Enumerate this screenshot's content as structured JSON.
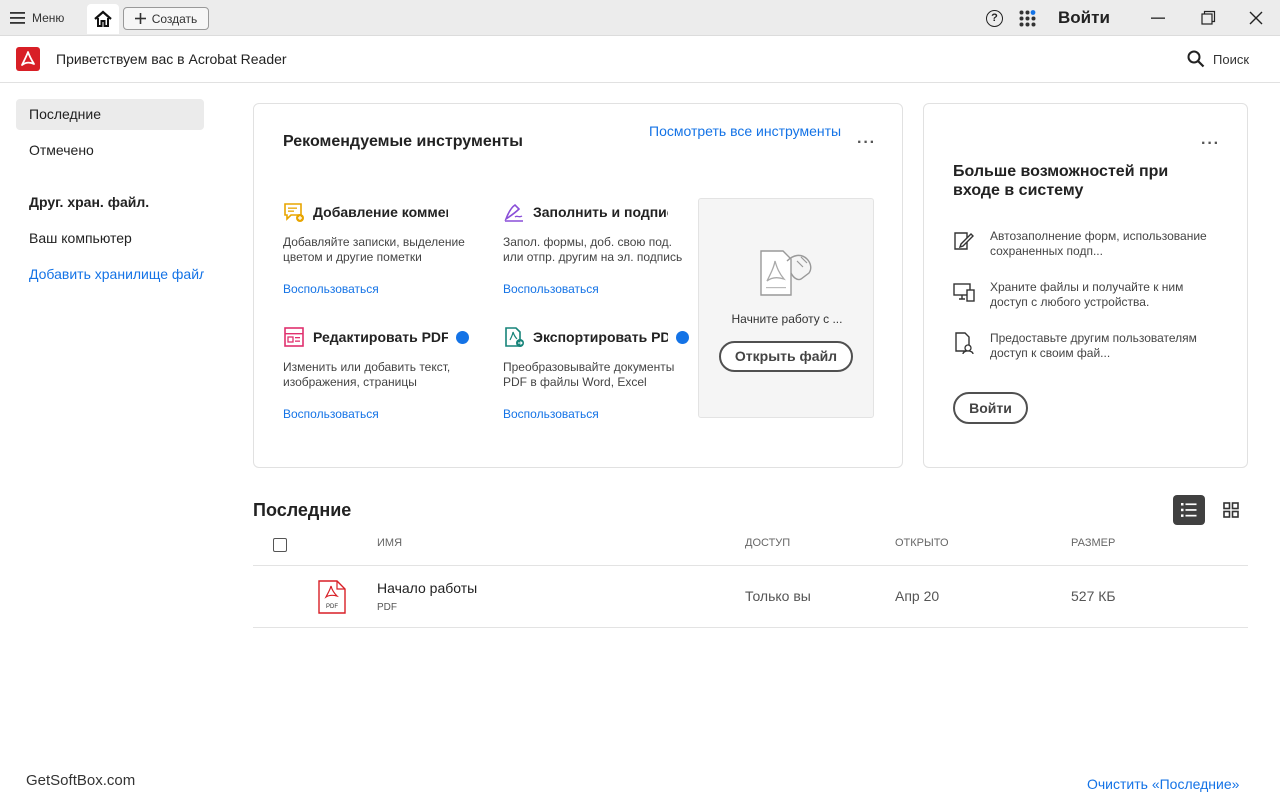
{
  "titlebar": {
    "menu_label": "Меню",
    "create_label": "Создать",
    "signin_label": "Войти"
  },
  "header": {
    "welcome": "Приветствуем вас в Acrobat Reader",
    "search_label": "Поиск"
  },
  "sidebar": {
    "items": [
      {
        "label": "Последние"
      },
      {
        "label": "Отмечено"
      },
      {
        "label": "Друг. хран. файл."
      },
      {
        "label": "Ваш компьютер"
      },
      {
        "label": "Добавить хранилище файлов"
      }
    ]
  },
  "tools_card": {
    "title": "Рекомендуемые инструменты",
    "see_all": "Посмотреть все инструменты",
    "tools": [
      {
        "name": "Добавление комментариев",
        "desc": "Добавляйте записки, выделение цветом и другие пометки",
        "action": "Воспользоваться"
      },
      {
        "name": "Заполнить и подписать",
        "desc": "Запол. формы, доб. свою под. или отпр. другим на эл. подпись",
        "action": "Воспользоваться"
      },
      {
        "name": "Редактировать PDF",
        "desc": "Изменить или добавить текст, изображения, страницы",
        "action": "Воспользоваться"
      },
      {
        "name": "Экспортировать PDF",
        "desc": "Преобразовывайте документы PDF в файлы Word, Excel",
        "action": "Воспользоваться"
      }
    ],
    "start_text": "Начните работу с ...",
    "open_button": "Открыть файл"
  },
  "signin_card": {
    "title": "Больше возможностей при входе в систему",
    "features": [
      {
        "text": "Автозаполнение форм, использование сохраненных подп..."
      },
      {
        "text": "Храните файлы и получайте к ним доступ с любого устройства."
      },
      {
        "text": "Предоставьте другим пользователям доступ к своим фай..."
      }
    ],
    "signin_button": "Войти"
  },
  "recent": {
    "title": "Последние",
    "columns": {
      "name": "Имя",
      "access": "Доступ",
      "opened": "Открыто",
      "size": "Размер"
    },
    "files": [
      {
        "name": "Начало работы",
        "type": "PDF",
        "access": "Только вы",
        "opened": "Апр 20",
        "size": "527 КБ"
      }
    ],
    "clear_label": "Очистить «Последние»"
  },
  "watermark": "GetSoftBox.com",
  "colors": {
    "accent": "#1473e6",
    "brand": "#d81f26",
    "active_view": "#404040"
  }
}
